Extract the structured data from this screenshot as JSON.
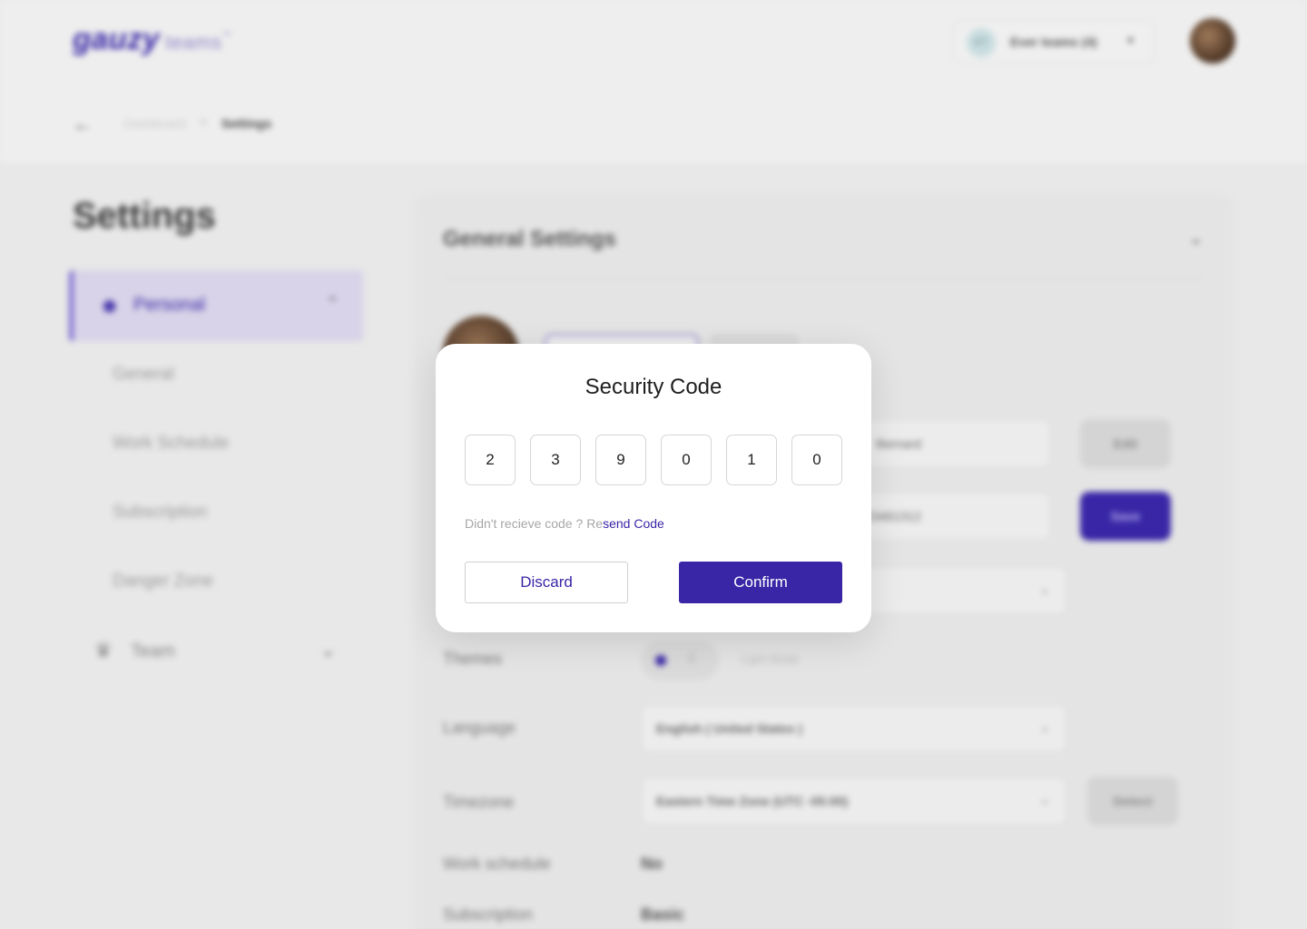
{
  "header": {
    "logo_text": "gauzy",
    "logo_sub": "teams",
    "logo_tm": "™",
    "team_badge": "ET",
    "team_name": "Ever teams (4)",
    "chevron": "▾"
  },
  "breadcrumb": {
    "back": "←",
    "items": [
      "Dashboard",
      "Settings"
    ],
    "separator": ">"
  },
  "sidebar": {
    "title": "Settings",
    "personal_label": "Personal",
    "items": [
      "General",
      "Work Schedule",
      "Subscription",
      "Danger Zone"
    ],
    "team_label": "Team"
  },
  "panel": {
    "title": "General Settings",
    "name_value": "Bernard",
    "phone_value": "+1 6523461312",
    "edit_label": "Edit",
    "save_label": "Save",
    "themes_label": "Themes",
    "theme_value": "Light Mode",
    "language_label": "Language",
    "language_value": "English ( United States )",
    "timezone_label": "Timezone",
    "timezone_value": "Eastern Time Zone (UTC -05:00)",
    "detect_label": "Detect",
    "work_schedule_label": "Work schedule",
    "work_schedule_value": "No",
    "subscription_label": "Subscription",
    "subscription_value": "Basic"
  },
  "modal": {
    "title": "Security Code",
    "digits": [
      "2",
      "3",
      "9",
      "0",
      "1",
      "0"
    ],
    "resend_prefix": "Didn't recieve code ? Re",
    "resend_link": "send Code",
    "discard_label": "Discard",
    "confirm_label": "Confirm"
  },
  "colors": {
    "brand": "#3826a6",
    "overlay_bg": "#e8e8e8",
    "modal_bg": "#ffffff"
  },
  "icons": [
    "back-arrow-icon",
    "user-icon",
    "chevron-up-icon",
    "chevron-down-icon",
    "team-icon",
    "moon-icon"
  ]
}
